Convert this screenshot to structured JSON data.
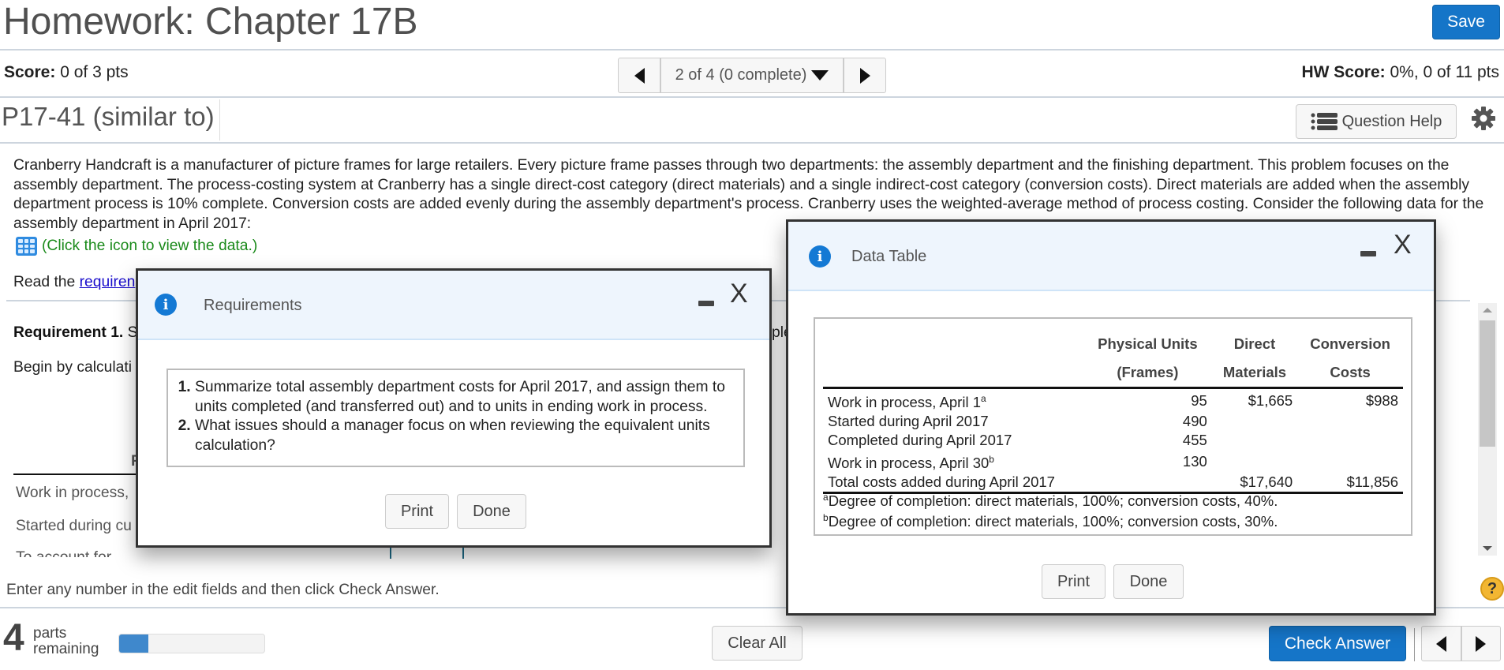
{
  "header": {
    "title": "Homework: Chapter 17B",
    "save_label": "Save"
  },
  "score": {
    "label": "Score:",
    "value": "0 of 3 pts",
    "hw_label": "HW Score:",
    "hw_value": "0%, 0 of 11 pts"
  },
  "question_nav": {
    "position": "2 of 4 (0 complete)"
  },
  "problem": {
    "id": "P17-41 (similar to)",
    "question_help_label": "Question Help",
    "text": "Cranberry Handcraft is a manufacturer of picture frames for large retailers. Every picture frame passes through two departments: the assembly department and the finishing department. This problem focuses on the assembly department. The process-costing system at Cranberry has a single direct-cost category (direct materials) and a single indirect-cost category (conversion costs). Direct materials are added when the assembly department process is 10% complete. Conversion costs are added evenly during the assembly department's process. Cranberry uses the weighted-average method of process costing. Consider the following data for the assembly department in April 2017:",
    "data_link": "(Click the icon to view the data.)",
    "read_prefix": "Read the ",
    "read_link": "requiren",
    "requirement1_label": "Requirement 1.",
    "requirement1_partial": " S",
    "begin_text": "Begin by calculati",
    "col_partial": "F",
    "rows_partial": [
      "Work in process,",
      "Started during cu",
      "To account for"
    ],
    "hidden_partial": "ple"
  },
  "instructions": "Enter any number in the edit fields and then click Check Answer.",
  "footer": {
    "parts_count": "4",
    "parts_label_1": "parts",
    "parts_label_2": "remaining",
    "progress_fraction": 0.2,
    "clear_all_label": "Clear All",
    "check_answer_label": "Check Answer",
    "help_glyph": "?"
  },
  "requirements_modal": {
    "title": "Requirements",
    "items": [
      "Summarize total assembly department costs for April 2017, and assign them to units completed (and transferred out) and to units in ending work in process.",
      "What issues should a manager focus on when reviewing the equivalent units calculation?"
    ],
    "print_label": "Print",
    "done_label": "Done"
  },
  "data_modal": {
    "title": "Data Table",
    "headers": {
      "col1_line1": "Physical Units",
      "col1_line2": "(Frames)",
      "col2_line1": "Direct",
      "col2_line2": "Materials",
      "col3_line1": "Conversion",
      "col3_line2": "Costs"
    },
    "rows": [
      {
        "label": "Work in process, April 1",
        "sup": "a",
        "units": "95",
        "dm": "$1,665",
        "cc": "$988"
      },
      {
        "label": "Started during April 2017",
        "sup": "",
        "units": "490",
        "dm": "",
        "cc": ""
      },
      {
        "label": "Completed during April 2017",
        "sup": "",
        "units": "455",
        "dm": "",
        "cc": ""
      },
      {
        "label": "Work in process, April 30",
        "sup": "b",
        "units": "130",
        "dm": "",
        "cc": ""
      },
      {
        "label": "Total costs added during April 2017",
        "sup": "",
        "units": "",
        "dm": "$17,640",
        "cc": "$11,856"
      }
    ],
    "footnotes": [
      {
        "mark": "a",
        "text": "Degree of completion: direct materials, 100%; conversion costs, 40%."
      },
      {
        "mark": "b",
        "text": "Degree of completion: direct materials, 100%; conversion costs, 30%."
      }
    ],
    "print_label": "Print",
    "done_label": "Done"
  },
  "colors": {
    "primary": "#1575c8",
    "link_green": "#1a8a1a",
    "link_blue": "#1a0dcc",
    "progress": "#3f88cc",
    "help_badge": "#f2b632"
  }
}
